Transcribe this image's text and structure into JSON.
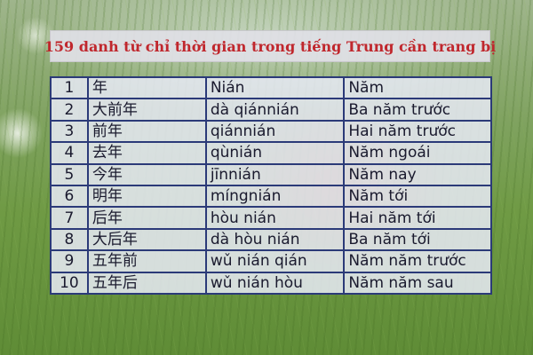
{
  "title": "159 danh từ chỉ thời gian trong tiếng Trung cần trang bị",
  "rows": [
    {
      "num": "1",
      "hanzi": "年",
      "pinyin": "Nián",
      "meaning": "Năm"
    },
    {
      "num": "2",
      "hanzi": "大前年",
      "pinyin": "dà qiánnián",
      "meaning": "Ba năm trước"
    },
    {
      "num": "3",
      "hanzi": "前年",
      "pinyin": "qiánnián",
      "meaning": "Hai năm trước"
    },
    {
      "num": "4",
      "hanzi": "去年",
      "pinyin": "qùnián",
      "meaning": "Năm ngoái"
    },
    {
      "num": "5",
      "hanzi": "今年",
      "pinyin": "jīnnián",
      "meaning": "Năm nay"
    },
    {
      "num": "6",
      "hanzi": "明年",
      "pinyin": "míngnián",
      "meaning": "Năm tới"
    },
    {
      "num": "7",
      "hanzi": "后年",
      "pinyin": "hòu nián",
      "meaning": "Hai năm tới"
    },
    {
      "num": "8",
      "hanzi": "大后年",
      "pinyin": "dà hòu nián",
      "meaning": "Ba năm tới"
    },
    {
      "num": "9",
      "hanzi": "五年前",
      "pinyin": "wǔ nián qián",
      "meaning": "Năm năm trước"
    },
    {
      "num": "10",
      "hanzi": "五年后",
      "pinyin": "wǔ nián hòu",
      "meaning": "Năm năm sau"
    }
  ],
  "colors": {
    "title": "#c0272d",
    "border": "#2b3a78",
    "text": "#1a1a2e"
  }
}
